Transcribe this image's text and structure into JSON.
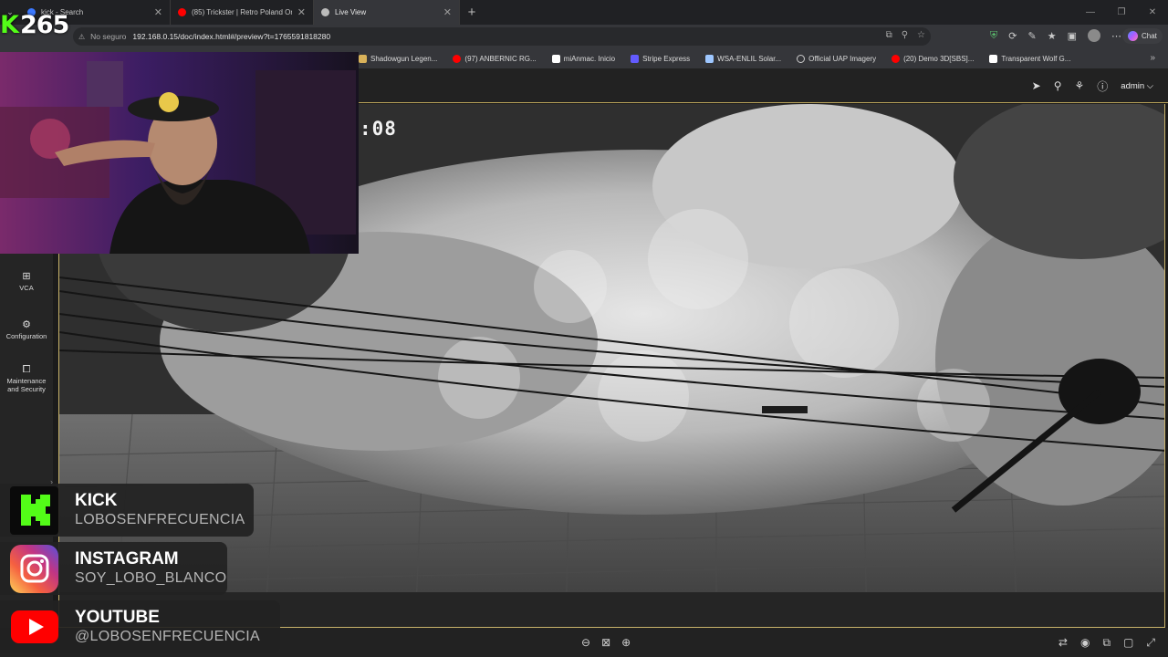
{
  "stream": {
    "counter_prefix": "K",
    "counter_value": "265"
  },
  "browser": {
    "tabs": [
      {
        "title": "kick - Search",
        "favicon_color": "#3b78ff",
        "active": false
      },
      {
        "title": "(85) Trickster | Retro Poland Origin",
        "favicon_color": "#ff0000",
        "active": false
      },
      {
        "title": "Live View",
        "favicon_color": "#bbbbbb",
        "active": true
      }
    ],
    "new_tab": "+",
    "window_controls": [
      "—",
      "❐",
      "✕"
    ],
    "address": {
      "security_label": "No seguro",
      "url": "192.168.0.15/doc/index.html#/preview?t=1765591818280"
    },
    "chat_label": "Chat",
    "bookmarks": [
      {
        "label": "Shadowgun Legen...",
        "color": "#d9b25a"
      },
      {
        "label": "(97) ANBERNIC RG...",
        "color": "#ff0000"
      },
      {
        "label": "miAnmac. Inicio",
        "color": "#ffffff"
      },
      {
        "label": "Stripe Express",
        "color": "#635bff"
      },
      {
        "label": "WSA-ENLIL Solar...",
        "color": "#9ec7ff"
      },
      {
        "label": "Official UAP Imagery",
        "color": "#cccccc"
      },
      {
        "label": "(20) Demo 3D[SBS]...",
        "color": "#ff0000"
      },
      {
        "label": "Transparent Wolf G...",
        "color": "#ffffff"
      }
    ],
    "bookmarks_more": "»"
  },
  "camera_ui": {
    "header": {
      "user": "admin",
      "user_chevron": "⌵"
    },
    "sidebar": [
      {
        "icon": "vca-icon",
        "label_line1": "VCA",
        "label_line2": ""
      },
      {
        "icon": "gear-icon",
        "label_line1": "Configuration",
        "label_line2": ""
      },
      {
        "icon": "maintenance-icon",
        "label_line1": "Maintenance",
        "label_line2": "and Security"
      }
    ],
    "osd_time": ":08"
  },
  "socials": [
    {
      "title": "KICK",
      "handle": "LOBOSENFRECUENCIA",
      "color": "#53fc18"
    },
    {
      "title": "INSTAGRAM",
      "handle": "SOY_LOBO_BLANCO",
      "color": "#e1306c"
    },
    {
      "title": "YOUTUBE",
      "handle": "@LOBOSENFRECUENCIA",
      "color": "#ff0000"
    }
  ]
}
